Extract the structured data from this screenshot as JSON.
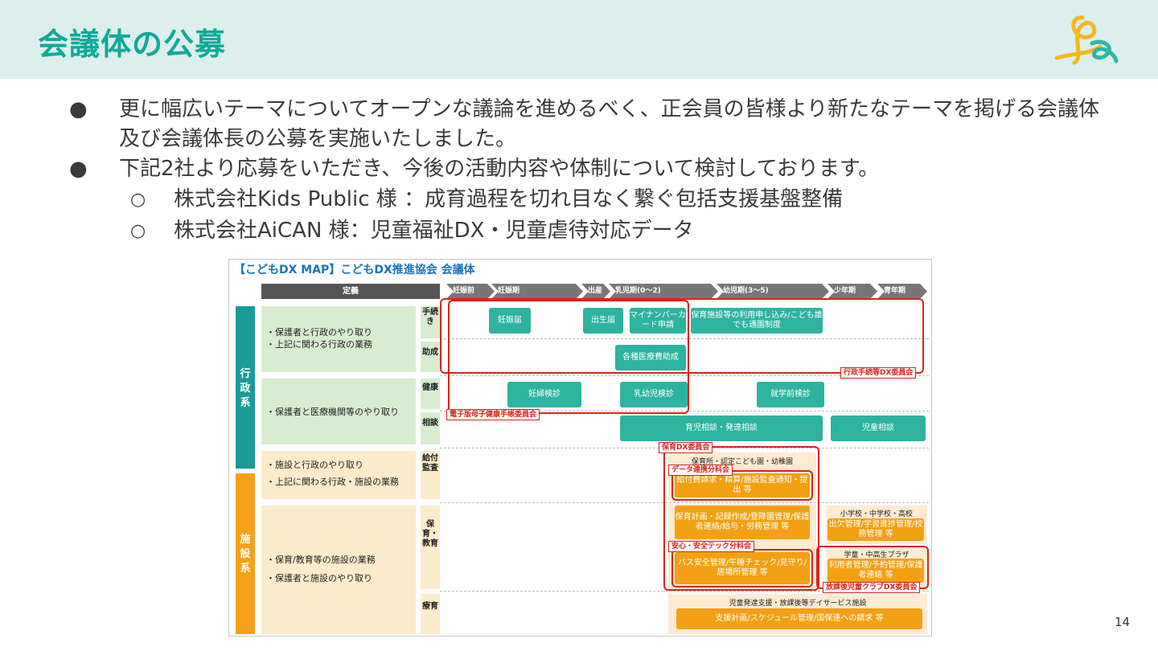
{
  "slide": {
    "title": "会議体の公募",
    "page_number": "14",
    "logo_icon": "kodomo-dx-logo",
    "bullets": [
      {
        "symbol": "●",
        "text": "更に幅広いテーマについてオープンな議論を進めるべく、正会員の皆様より新たなテーマを掲げる会議体及び会議体長の公募を実施いたしました。"
      },
      {
        "symbol": "●",
        "text": "下記2社より応募をいただき、今後の活動内容や体制について検討しております。"
      }
    ],
    "sub_bullets": [
      {
        "symbol": "○",
        "text": "株式会社Kids Public 様 ：成育過程を切れ目なく繋ぐ包括支援基盤整備"
      },
      {
        "symbol": "○",
        "text": "株式会社AiCAN 様：児童福祉DX・児童虐待対応データ"
      }
    ]
  },
  "map": {
    "title": "【こどもDX MAP】こどもDX推進協会 会議体",
    "definition_header": "定義",
    "stages": [
      "妊娠前",
      "妊娠期",
      "出産",
      "乳児期(0〜2)",
      "幼児期(3〜5)",
      "少年期",
      "青年期"
    ],
    "categories": {
      "gyosei": "行政系",
      "shisetsu": "施設系"
    },
    "row_labels": {
      "r1_a": "・保護者と行政のやり取り",
      "r1_b": "・上記に関わる行政の業務",
      "r2": "・保護者と医療機関等のやり取り",
      "r3_a": "・施設と行政のやり取り",
      "r3_b": "・上記に関わる行政・施設の業務",
      "r4_a": "・保育/教育等の施設の業務",
      "r4_b": "・保護者と施設のやり取り"
    },
    "sub_labels": {
      "tetsuzuki": "手続き",
      "josei": "助成",
      "kenko": "健康",
      "sodan": "相談",
      "kyufu": "給付監査",
      "hoiku": "保育・教育",
      "ryoiku": "療育"
    },
    "green_boxes": {
      "ninshin_todoke": "妊娠届",
      "shussei_todoke": "出生届",
      "mynumber": "マイナンバーカード申請",
      "hoiku_moushikomi": "保育施設等の利用申し込み/こども誰でも通園制度",
      "iryohi": "各種医療費助成",
      "ninpu_kenshin": "妊婦検診",
      "nyuyouji_kenshin": "乳幼児検診",
      "shugakumae": "就学前検診",
      "ikuji_sodan": "育児相談・発達相談",
      "jido_sodan": "児童相談"
    },
    "orange_boxes": {
      "kyufuhi": "給付費請求・精算/施設監査通知・提出 等",
      "hoiku_keikaku": "保育計画・記録作成/登降園管理/保護者連絡/給与・労務管理 等",
      "bus": "バス安全管理/午睡チェック/見守り/居場所管理 等",
      "shugaku": "出欠管理/学習進捗管理/校務管理 等",
      "gakudo": "利用者管理/予約管理/保護者連絡 等",
      "shien": "支援計画/スケジュール管理/国保連への請求 等"
    },
    "pale_texts": {
      "hoikusho": "保育所・認定こども園・幼稚園",
      "shochugaku": "小学校・中学校・高校",
      "gakudo": "学童・中高生プラザ",
      "jido_hattatsu": "児童発達支援・放課後等デイサービス施設"
    },
    "committees": {
      "gyosei_tetsuzuki": "行政手続等DX委員会",
      "boshi_techo": "電子版母子健康手帳委員会",
      "hoiku_dx": "保育DX委員会",
      "data_renkei": "データ連携分科会",
      "anshin": "安心・安全テック分科会",
      "hokago": "放課後児童クラブDX委員会"
    },
    "colors": {
      "green": "#2db3a0",
      "orange": "#f2a114",
      "teal_side": "#1a9a9a",
      "orange_side": "#f5a01a",
      "red": "#d9251c",
      "header_bg": "#dcefec",
      "title": "#10a99b"
    }
  }
}
